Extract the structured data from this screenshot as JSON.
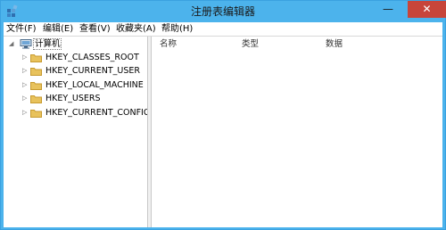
{
  "window": {
    "title": "注册表编辑器",
    "minimize_glyph": "—",
    "maximize_glyph": "☐",
    "close_glyph": "✕"
  },
  "menu": {
    "items": [
      {
        "label": "文件(F)"
      },
      {
        "label": "编辑(E)"
      },
      {
        "label": "查看(V)"
      },
      {
        "label": "收藏夹(A)"
      },
      {
        "label": "帮助(H)"
      }
    ]
  },
  "tree": {
    "root": {
      "label": "计算机",
      "expander": "◢"
    },
    "children": [
      {
        "label": "HKEY_CLASSES_ROOT",
        "expander": "▷"
      },
      {
        "label": "HKEY_CURRENT_USER",
        "expander": "▷"
      },
      {
        "label": "HKEY_LOCAL_MACHINE",
        "expander": "▷"
      },
      {
        "label": "HKEY_USERS",
        "expander": "▷"
      },
      {
        "label": "HKEY_CURRENT_CONFIG",
        "expander": "▷"
      }
    ]
  },
  "list": {
    "columns": [
      "名称",
      "类型",
      "数据"
    ]
  },
  "colors": {
    "titlebar": "#4cb3ec",
    "close_button": "#c7453a",
    "folder": "#e8c25c"
  }
}
